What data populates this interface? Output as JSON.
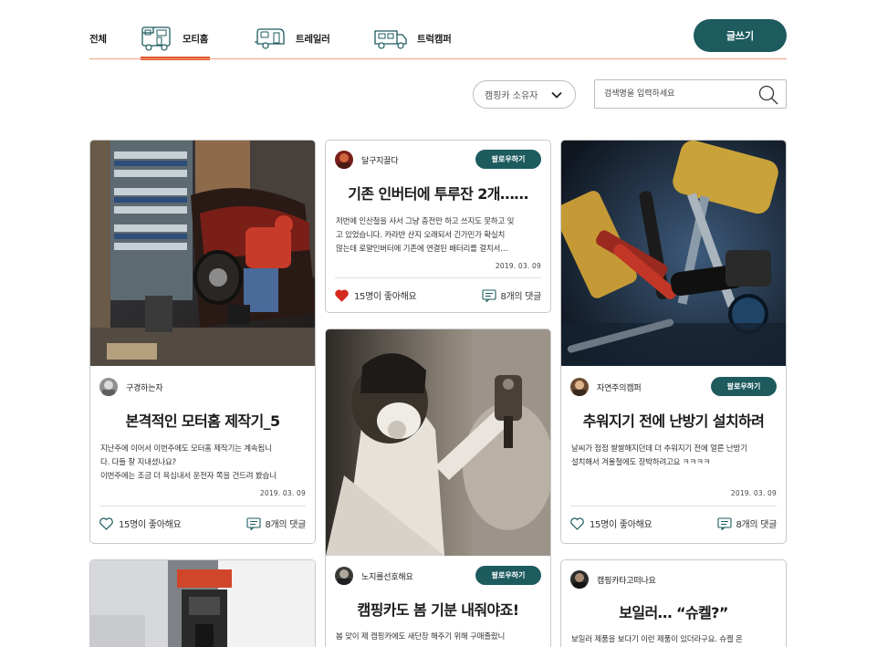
{
  "nav": {
    "tabs": [
      {
        "label": "전체",
        "icon": ""
      },
      {
        "label": "모티홈",
        "icon": "motorhome-icon"
      },
      {
        "label": "트레일러",
        "icon": "trailer-icon"
      },
      {
        "label": "트럭캠퍼",
        "icon": "truck-camper-icon"
      }
    ],
    "active_tab": "모티홈",
    "write_button": "글쓰기",
    "accent_color": "#e2572b",
    "button_color": "#1d5b5f"
  },
  "filters": {
    "select_value": "캠핑카 소유자",
    "search_placeholder": "검색명을 입력하세요"
  },
  "cards": [
    {
      "author": "구경하는자",
      "follow": "",
      "title": "본격적인 모터홈 제작기_5",
      "excerpt": [
        "지난주에 이어서 이번주에도 모터홈 제작기는 계속됩니",
        "다. 다들 잘 지내셨나요?",
        "이번주에는 조금 더 욕심내서 운전자 쪽을 건드려 봤습니"
      ],
      "date": "2019. 03. 09",
      "likes": "15명이 좋아해요",
      "liked": false,
      "comments": "8개의 댓글",
      "photo": "car-repair-photo"
    },
    {
      "author": "달구지끌다",
      "follow": "팔로우하기",
      "title": "기존 인버터에 투루잔 2개……",
      "excerpt": [
        "저번에 인산철을 사서 그냥 충전만 하고 쓰지도 못하고 잊",
        "고 있었습니다. 카라반 산지 오래되서 긴가민가 확실치",
        "않는데 로얄인버터에 기존에 연결된 배터리를 걸치서…"
      ],
      "date": "2019. 03. 09",
      "likes": "15명이 좋아해요",
      "liked": true,
      "comments": "8개의 댓글",
      "photo": ""
    },
    {
      "author": "자연주의캠퍼",
      "follow": "팔로우하기",
      "title": "추워지기 전에 난방기 설치하려",
      "excerpt": [
        "날씨가 점점 쌀쌀해지던데 더 추워지기 전에 얼른 난방기",
        "설치해서 겨울철에도 장박하려고요 ㅋㅋㅋㅋ"
      ],
      "date": "2019. 03. 09",
      "likes": "15명이 좋아해요",
      "liked": false,
      "comments": "8개의 댓글",
      "photo": "tools-photo"
    },
    {
      "author": "노지를선호해요",
      "follow": "팔로우하기",
      "title": "캠핑카도 봄 기분 내줘야죠!",
      "excerpt": [
        "봄 맞이 제 캠핑카에도 새단장 해주기 위해 구매졸랐니"
      ],
      "date": "",
      "likes": "",
      "liked": false,
      "comments": "",
      "photo": "spray-painter-photo"
    },
    {
      "author": "캠핑카타고떠나요",
      "follow": "",
      "title": "보일러… “슈켈?”",
      "excerpt": [
        "보일러 제품을 보다기 이런 제품이 있더라구요. 슈켈 온"
      ],
      "date": "",
      "likes": "",
      "liked": false,
      "comments": "",
      "photo": ""
    },
    {
      "author": "",
      "follow": "",
      "title": "",
      "excerpt": [],
      "date": "",
      "likes": "",
      "liked": false,
      "comments": "",
      "photo": "drill-photo"
    }
  ]
}
